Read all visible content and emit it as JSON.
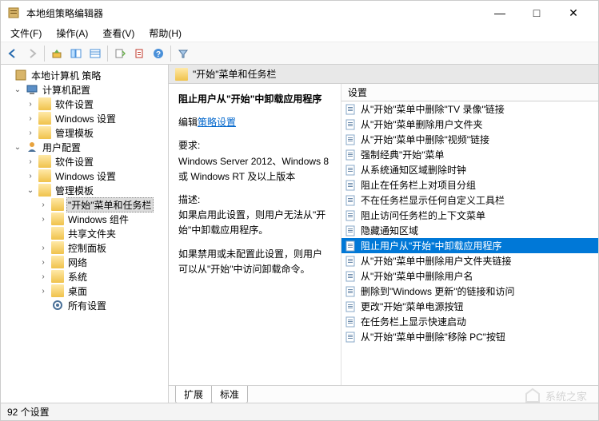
{
  "window": {
    "title": "本地组策略编辑器",
    "min": "—",
    "max": "□",
    "close": "✕"
  },
  "menubar": [
    "文件(F)",
    "操作(A)",
    "查看(V)",
    "帮助(H)"
  ],
  "tree": {
    "root": "本地计算机 策略",
    "computer": "计算机配置",
    "c_soft": "软件设置",
    "c_win": "Windows 设置",
    "c_tpl": "管理模板",
    "user": "用户配置",
    "u_soft": "软件设置",
    "u_win": "Windows 设置",
    "u_tpl": "管理模板",
    "start": "\"开始\"菜单和任务栏",
    "wincomp": "Windows 组件",
    "shared": "共享文件夹",
    "ctrlpanel": "控制面板",
    "network": "网络",
    "system": "系统",
    "desktop": "桌面",
    "allset": "所有设置"
  },
  "content": {
    "header": "\"开始\"菜单和任务栏",
    "setting_title": "阻止用户从\"开始\"中卸载应用程序",
    "edit_label": "编辑",
    "edit_link": "策略设置",
    "req_label": "要求:",
    "req_text": "Windows Server 2012、Windows 8 或 Windows RT 及以上版本",
    "desc_label": "描述:",
    "desc_p1": "如果启用此设置，则用户无法从\"开始\"中卸载应用程序。",
    "desc_p2": "如果禁用或未配置此设置，则用户可以从\"开始\"中访问卸载命令。",
    "list_header": "设置",
    "items": [
      "从\"开始\"菜单中删除\"TV 录像\"链接",
      "从\"开始\"菜单删除用户文件夹",
      "从\"开始\"菜单中删除\"视频\"链接",
      "强制经典\"开始\"菜单",
      "从系统通知区域删除时钟",
      "阻止在任务栏上对项目分组",
      "不在任务栏显示任何自定义工具栏",
      "阻止访问任务栏的上下文菜单",
      "隐藏通知区域",
      "阻止用户从\"开始\"中卸载应用程序",
      "从\"开始\"菜单中删除用户文件夹链接",
      "从\"开始\"菜单中删除用户名",
      "删除到\"Windows 更新\"的链接和访问",
      "更改\"开始\"菜单电源按钮",
      "在任务栏上显示快速启动",
      "从\"开始\"菜单中删除\"移除 PC\"按钮"
    ],
    "selected_index": 9
  },
  "tabs": {
    "extended": "扩展",
    "standard": "标准"
  },
  "status": "92 个设置",
  "watermark": "系统之家"
}
